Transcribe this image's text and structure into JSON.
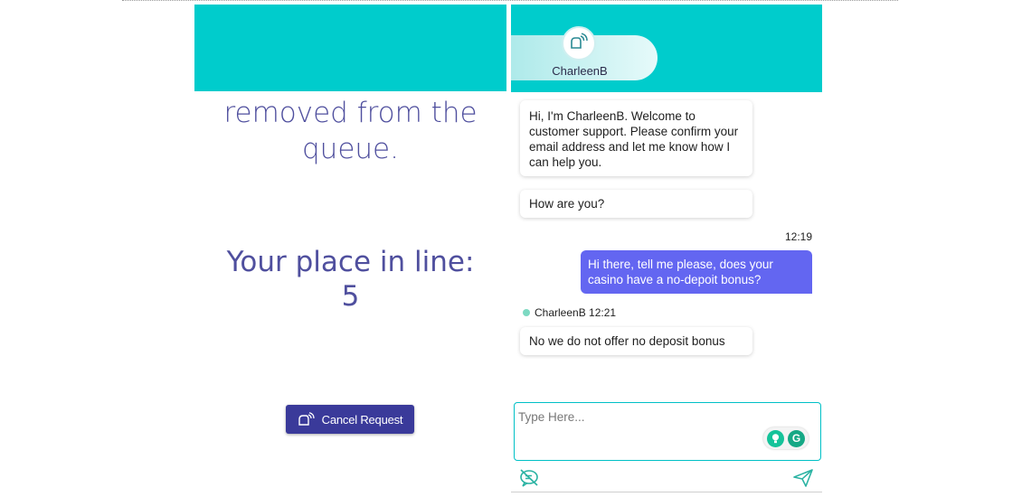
{
  "queue": {
    "message_lines": [
      "removed from the",
      "queue."
    ],
    "place_label": "Your place in line:",
    "place_value": "5",
    "cancel_label": "Cancel Request"
  },
  "chat": {
    "agent_name": "CharleenB",
    "messages": [
      {
        "from": "agent",
        "text": "Hi, I'm CharleenB. Welcome to customer support. Please confirm your email address and let me know how I can help you."
      },
      {
        "from": "agent",
        "text": "How are you?"
      },
      {
        "from": "user",
        "time": "12:19",
        "text": "Hi there, tell me please, does your casino have a no-depoit bonus?"
      },
      {
        "from": "agent",
        "meta": "CharleenB 12:21",
        "text": "No we do not offer no deposit bonus"
      }
    ],
    "input_placeholder": "Type Here...",
    "grammarly_letter": "G"
  },
  "colors": {
    "header": "#00cccc",
    "user_bubble": "#6366f1",
    "cancel_button": "#3a3a9a",
    "queue_text": "#4f4f9e",
    "send_icon": "#2bb3a3",
    "online_dot": "#7dd9c2"
  },
  "icons": [
    "chat-logo-icon",
    "emoji-disabled-icon",
    "send-icon",
    "idea-bulb-icon",
    "grammarly-icon"
  ]
}
